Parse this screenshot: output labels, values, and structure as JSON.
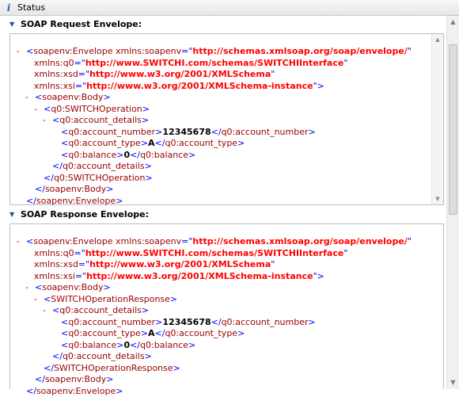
{
  "status_bar": {
    "title": "Status",
    "icon": "info-icon"
  },
  "request": {
    "header": "SOAP Request Envelope:",
    "xml": {
      "env_open": "soapenv:Envelope",
      "ns": [
        {
          "name": "xmlns:soapenv",
          "value": "http://schemas.xmlsoap.org/soap/envelope/"
        },
        {
          "name": "xmlns:q0",
          "value": "http://www.SWITCHI.com/schemas/SWITCHIInterface"
        },
        {
          "name": "xmlns:xsd",
          "value": "http://www.w3.org/2001/XMLSchema"
        },
        {
          "name": "xmlns:xsi",
          "value": "http://www.w3.org/2001/XMLSchema-instance"
        }
      ],
      "body": "soapenv:Body",
      "operation": "q0:SWITCHOperation",
      "details": "q0:account_details",
      "fields": [
        {
          "tag": "q0:account_number",
          "value": "12345678"
        },
        {
          "tag": "q0:account_type",
          "value": "A"
        },
        {
          "tag": "q0:balance",
          "value": "0"
        }
      ]
    }
  },
  "response": {
    "header": "SOAP Response Envelope:",
    "xml": {
      "env_open": "soapenv:Envelope",
      "ns": [
        {
          "name": "xmlns:soapenv",
          "value": "http://schemas.xmlsoap.org/soap/envelope/"
        },
        {
          "name": "xmlns:q0",
          "value": "http://www.SWITCHI.com/schemas/SWITCHIInterface"
        },
        {
          "name": "xmlns:xsd",
          "value": "http://www.w3.org/2001/XMLSchema"
        },
        {
          "name": "xmlns:xsi",
          "value": "http://www.w3.org/2001/XMLSchema-instance"
        }
      ],
      "body": "soapenv:Body",
      "operation": "SWITCHOperationResponse",
      "details": "q0:account_details",
      "fields": [
        {
          "tag": "q0:account_number",
          "value": "12345678"
        },
        {
          "tag": "q0:account_type",
          "value": "A"
        },
        {
          "tag": "q0:balance",
          "value": "0"
        }
      ]
    }
  }
}
